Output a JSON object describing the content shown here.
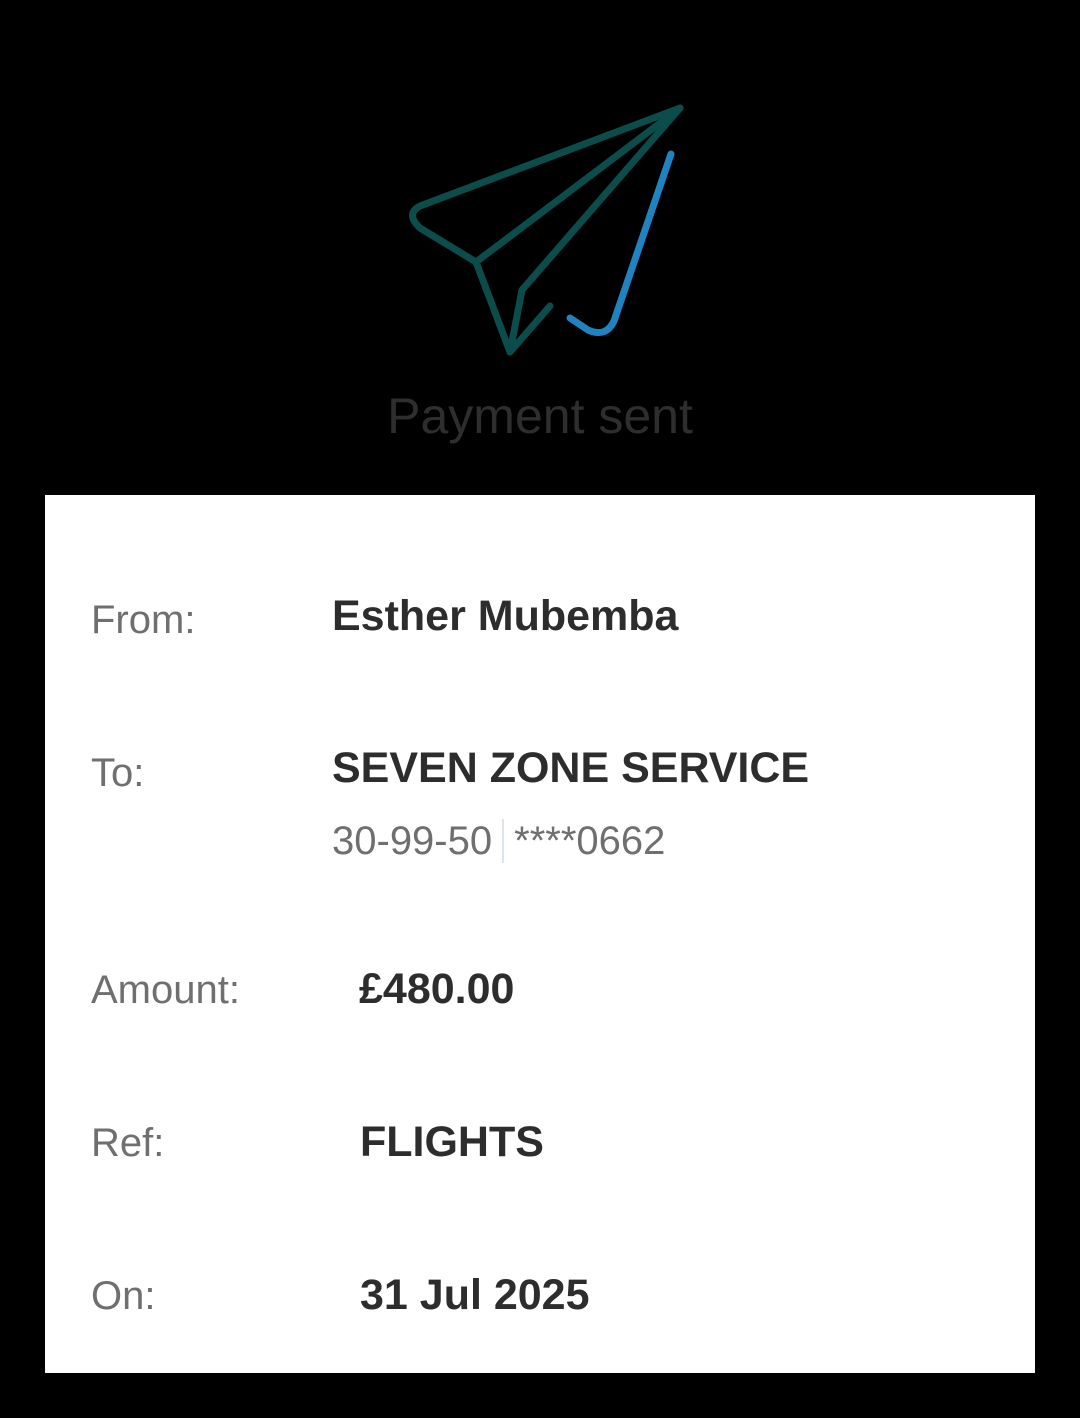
{
  "header": {
    "icon": "paper-plane-check-icon",
    "title": "Payment sent",
    "colors": {
      "plane": "#0b4d4b",
      "check": "#1f83c1"
    }
  },
  "details": {
    "from_label": "From:",
    "from_value": "Esther Mubemba",
    "to_label": "To:",
    "to_value": "SEVEN ZONE SERVICE",
    "sort_code": "30-99-50",
    "account_masked": "****0662",
    "amount_label": "Amount:",
    "amount_value": "£480.00",
    "ref_label": "Ref:",
    "ref_value": "FLIGHTS",
    "on_label": "On:",
    "on_value": "31 Jul 2025"
  }
}
